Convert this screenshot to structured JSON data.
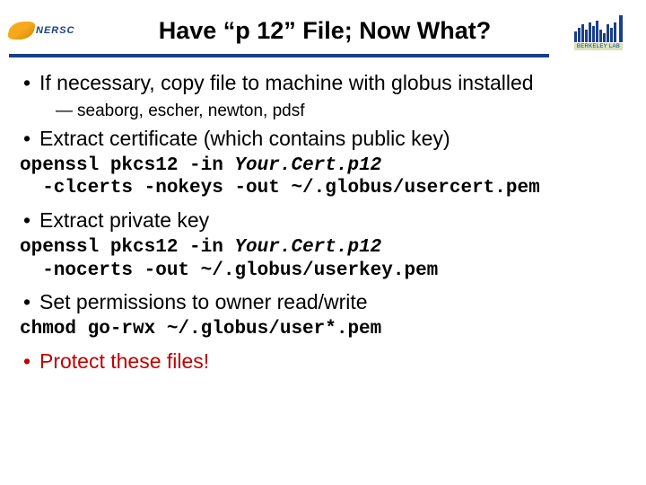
{
  "header": {
    "left_logo_text": "NERSC",
    "title": "Have “p 12” File; Now What?",
    "right_logo_label": "BERKELEY LAB"
  },
  "bullets": {
    "b1": "If necessary, copy file to machine with globus installed",
    "b1_sub": "seaborg, escher, newton, pdsf",
    "b2": "Extract certificate (which contains public key)",
    "b3": "Extract private key",
    "b4": "Set permissions to owner read/write",
    "b5": "Protect these files!"
  },
  "code": {
    "c1_a": "openssl pkcs12 -in ",
    "c1_ital": "Your.Cert.p12",
    "c1_b": "\n  -clcerts -nokeys -out ~/.globus/usercert.pem",
    "c2_a": "openssl pkcs12 -in ",
    "c2_ital": "Your.Cert.p12",
    "c2_b": "\n  -nocerts -out ~/.globus/userkey.pem",
    "c3": "chmod go-rwx ~/.globus/user*.pem"
  }
}
